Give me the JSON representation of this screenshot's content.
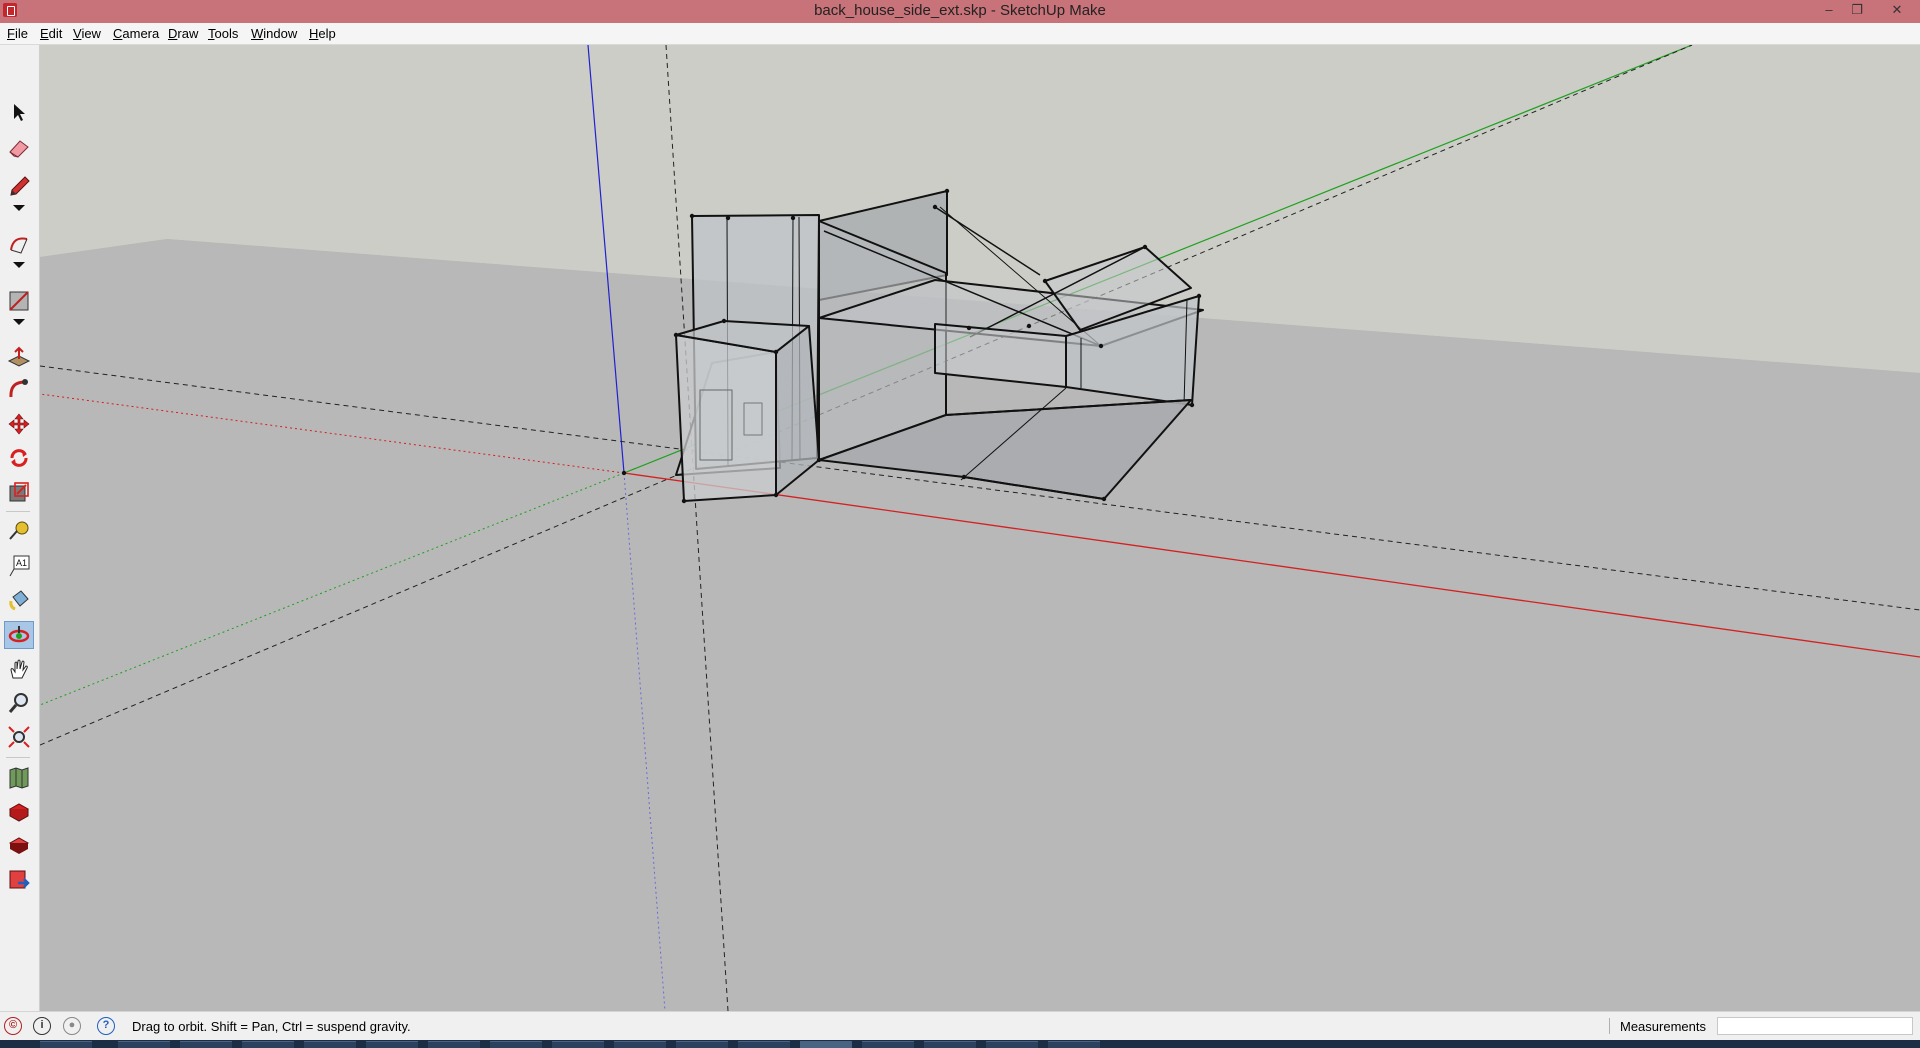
{
  "window": {
    "title": "back_house_side_ext.skp - SketchUp Make",
    "minimize_glyph": "–",
    "restore_glyph": "❐",
    "close_glyph": "✕"
  },
  "menu": [
    "File",
    "Edit",
    "View",
    "Camera",
    "Draw",
    "Tools",
    "Window",
    "Help"
  ],
  "tools": [
    "select-tool",
    "eraser-tool",
    "line-tool",
    "line-options-arrow",
    "arc-tool",
    "arc-options-arrow",
    "rectangle-tool",
    "shape-options-arrow",
    "push-pull-tool",
    "follow-me-tool",
    "move-tool",
    "rotate-tool",
    "scale-tool",
    "tape-measure-tool",
    "text-tool",
    "paint-bucket-tool",
    "orbit-tool",
    "pan-tool",
    "zoom-tool",
    "zoom-extents-tool",
    "3d-warehouse-tool",
    "extension-warehouse-tool",
    "layout-tool",
    "send-to-layout-tool"
  ],
  "active_tool": "orbit-tool",
  "text_tool_label": "A1",
  "status": {
    "hint": "Drag to orbit. Shift = Pan, Ctrl = suspend gravity.",
    "measurements_label": "Measurements",
    "measurements_value": ""
  },
  "colors": {
    "titlebar": "#c8737a",
    "sky": "#cdcdc8",
    "ground": "#b8b8b8",
    "red_axis": "#d42020",
    "green_axis": "#1ea01e",
    "blue_axis": "#2020d0",
    "selection": "#a8c6e6"
  }
}
